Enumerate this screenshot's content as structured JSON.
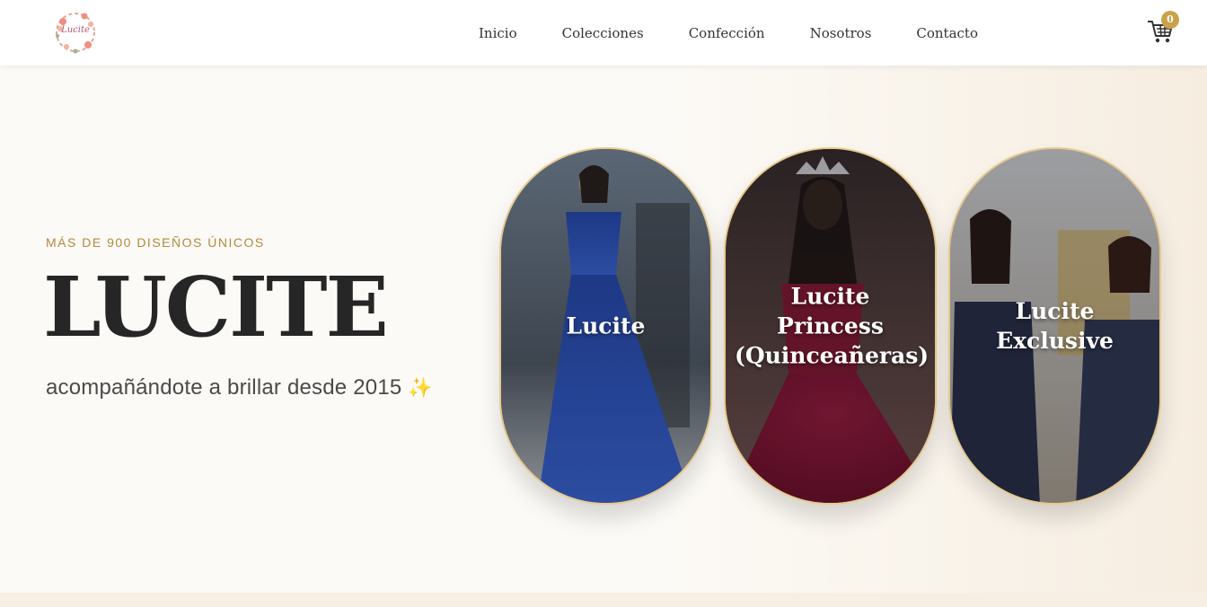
{
  "header": {
    "logo_text": "Lucite",
    "nav": [
      {
        "label": "Inicio"
      },
      {
        "label": "Colecciones"
      },
      {
        "label": "Confección"
      },
      {
        "label": "Nosotros"
      },
      {
        "label": "Contacto"
      }
    ],
    "cart_count": "0",
    "cart_icon": "shopping-cart-icon"
  },
  "hero": {
    "eyebrow": "MÁS DE 900 DISEÑOS ÚNICOS",
    "title": "LUCITE",
    "subtitle": "acompañándote a brillar desde 2015",
    "sparkle": "✨"
  },
  "collections": [
    {
      "label": "Lucite"
    },
    {
      "label": "Lucite Princess (Quinceañeras)"
    },
    {
      "label": "Lucite Exclusive"
    }
  ],
  "colors": {
    "accent_gold": "#c9a24a",
    "eyebrow_gold": "#b08a3e",
    "title": "#262626",
    "background": "#fbf8f3"
  }
}
